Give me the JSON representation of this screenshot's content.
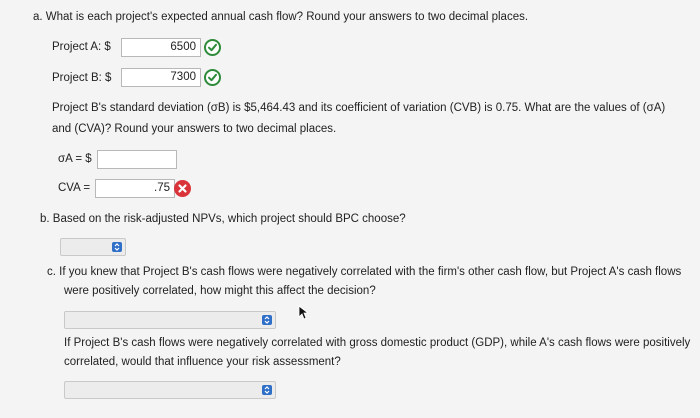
{
  "part_a": {
    "question": "a. What is each project's expected annual cash flow? Round your answers to two decimal places.",
    "project_a_label": "Project A: $",
    "project_a_value": "6500",
    "project_b_label": "Project B: $",
    "project_b_value": "7300",
    "sd_text_line1": "Project B's standard deviation (σB) is $5,464.43 and its coefficient of variation (CVB) is 0.75. What are the values of (σA)",
    "sd_text_line2": "and (CVA)? Round your answers to two decimal places.",
    "sigma_label": "σA = $",
    "sigma_value": "",
    "cv_label": "CVA =",
    "cv_value": ".75"
  },
  "part_b": {
    "question": "b. Based on the risk-adjusted NPVs, which project should BPC choose?"
  },
  "part_c": {
    "question_line1": "c. If you knew that Project B's cash flows were negatively correlated with the firm's other cash flow, but Project A's cash flows",
    "question_line2": "were positively correlated, how might this affect the decision?",
    "followup_line1": "If Project B's cash flows were negatively correlated with gross domestic product (GDP), while A's cash flows were positively",
    "followup_line2": "correlated, would that influence your risk assessment?"
  },
  "colors": {
    "correct": "#2e8b3a",
    "incorrect": "#d9343a",
    "select_accent": "#2f6fc7"
  },
  "icons": {
    "correct": "check-circle-icon",
    "incorrect": "x-circle-icon",
    "select": "select-chevrons-icon",
    "pointer": "mouse-cursor-icon"
  }
}
